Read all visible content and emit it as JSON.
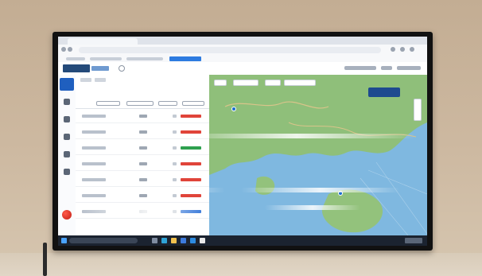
{
  "scene": {
    "subject": "wall-mounted-monitor",
    "colors": {
      "wall": "#c9b59c",
      "bezel": "#111111",
      "brand": "#244a7a",
      "accent": "#1f5fbf",
      "map_land": "#8fbf7a",
      "map_water": "#7fb8e0",
      "taskbar": "#1b2330"
    }
  },
  "browser": {
    "tab_title": "",
    "icons": [
      "back-icon",
      "forward-icon",
      "refresh-icon",
      "star-icon",
      "profile-icon",
      "menu-icon"
    ]
  },
  "app": {
    "nav_icons": [
      "home-icon",
      "truck-icon",
      "doc-icon",
      "chart-icon",
      "settings-icon",
      "user-icon"
    ],
    "table": {
      "rows": 7,
      "status_colors": [
        "#e0443a",
        "#e0443a",
        "#2ea04f",
        "#e0443a",
        "#e0443a",
        "#e0443a",
        "#2a6fd6"
      ]
    },
    "map": {
      "markers": 2
    }
  },
  "taskbar": {
    "icons": [
      "start-icon",
      "search-icon",
      "taskview-icon",
      "edge-icon",
      "explorer-icon",
      "store-icon",
      "mail-icon",
      "chrome-icon"
    ]
  }
}
